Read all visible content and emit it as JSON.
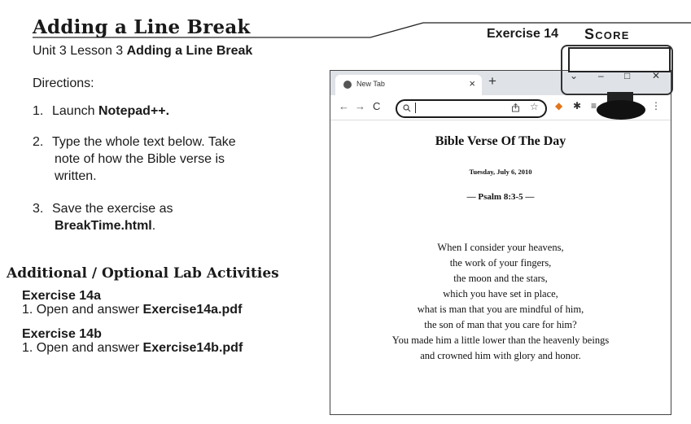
{
  "header": {
    "title": "Adding a Line Break",
    "subtitle_prefix": "Unit 3 Lesson 3 ",
    "subtitle_bold": "Adding a Line Break",
    "exercise": "Exercise 14",
    "score": "Score"
  },
  "directions": {
    "label": "Directions:",
    "steps": [
      {
        "num": "1.",
        "text": "Launch ",
        "bold": "Notepad++."
      },
      {
        "num": "2.",
        "line1": "Type the whole text below. Take",
        "line2": "note of how the Bible verse is",
        "line3": "written."
      },
      {
        "num": "3.",
        "line1": "Save the exercise as",
        "bold": "BreakTime.html",
        "after": "."
      }
    ]
  },
  "additional": {
    "title": "Additional / Optional Lab Activities",
    "a": {
      "heading": "Exercise 14a",
      "num": "1.",
      "text": "Open and answer ",
      "file": "Exercise14a.pdf"
    },
    "b": {
      "heading": "Exercise 14b",
      "num": "1.",
      "text": "Open and answer ",
      "file": "Exercise14b.pdf"
    }
  },
  "browser": {
    "tab_title": "New Tab",
    "tab_close": "×",
    "new_tab": "+",
    "back": "←",
    "forward": "→",
    "reload": "C",
    "search_icon": "search-icon",
    "controls": {
      "chevron": "⌄",
      "minimize": "–",
      "maximize": "□",
      "close": "✕"
    },
    "kebab": "⋮"
  },
  "page": {
    "heading": "Bible Verse Of The Day",
    "date": "Tuesday, July 6, 2010",
    "reference": "— Psalm 8:3-5 —",
    "verse": [
      "When I consider your heavens,",
      "the work of your fingers,",
      "the moon and the stars,",
      "which you have set in place,",
      "what is man that you are mindful of him,",
      "the son of man that you care for him?",
      "You made him a little lower than the heavenly beings",
      "and crowned him with glory and honor."
    ]
  }
}
